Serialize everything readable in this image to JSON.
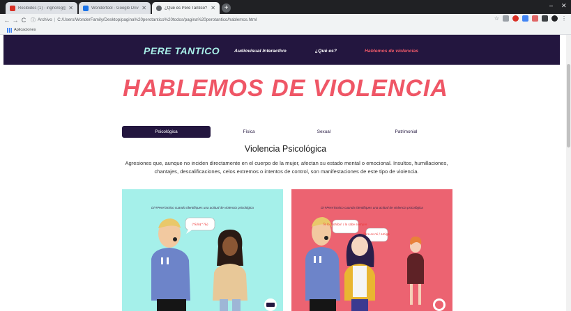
{
  "browser": {
    "tabs": [
      {
        "label": "Recibidos (1) - ingnoreg@student.es",
        "active": false,
        "favicon_color": "#d93025"
      },
      {
        "label": "Wondertool - Google Drive",
        "active": false,
        "favicon_color": "#1a73e8"
      },
      {
        "label": "¿Qué es Pere Tantico?",
        "active": true,
        "favicon_color": "#5f6368"
      }
    ],
    "new_tab_glyph": "+",
    "window_controls": [
      "‒",
      "✕"
    ],
    "address": {
      "info_label": "Archivo",
      "url": "C:/Users/WonderFamily/Desktop/pagina%20perotantico%20todos/pagina%20perotantico/hablemos.html"
    },
    "bookmarks_bar": {
      "apps_label": "Aplicaciones"
    },
    "extension_colors": [
      "#9aa0a6",
      "#6aa84f",
      "#d93025",
      "#4285f4",
      "#e06666",
      "#3c4043",
      "#202124"
    ]
  },
  "site": {
    "brand": "PERE TANTICO",
    "nav": [
      {
        "label": "Audiovisual Interactivo",
        "current": false
      },
      {
        "label": "¿Qué es?",
        "current": false
      },
      {
        "label": "Hablemos de violencias",
        "current": true
      }
    ],
    "hero_title": "HABLEMOS DE VIOLENCIA",
    "violence_tabs": [
      {
        "label": "Psicológica",
        "active": true
      },
      {
        "label": "Física",
        "active": false
      },
      {
        "label": "Sexual",
        "active": false
      },
      {
        "label": "Patrimonial",
        "active": false
      }
    ],
    "section_title": "Violencia Psicológica",
    "section_text": "Agresiones que, aunque no inciden directamente en el cuerpo de la mujer, afectan su estado mental o emocional. Insultos, humillaciones, chantajes, descalificaciones, celos extremos o intentos de control, son manifestaciones de este tipo de violencia.",
    "cards": [
      {
        "caption": "Di #PereTantico cuando identifiques una actitud de violencia psicológica",
        "bg": "#a5f0ea",
        "bubbles": [
          "(*&%$^?&)"
        ]
      },
      {
        "caption": "Di #PereTantico cuando identifiques una actitud de violencia psicológica",
        "bg": "#ec6371",
        "bubbles": [
          "Te lo prohibo! / lo sabe siempre",
          "Pero es mi / amiga"
        ]
      }
    ]
  },
  "colors": {
    "nav_bg": "#23163f",
    "brand": "#a8f0e8",
    "accent": "#ef5666"
  }
}
